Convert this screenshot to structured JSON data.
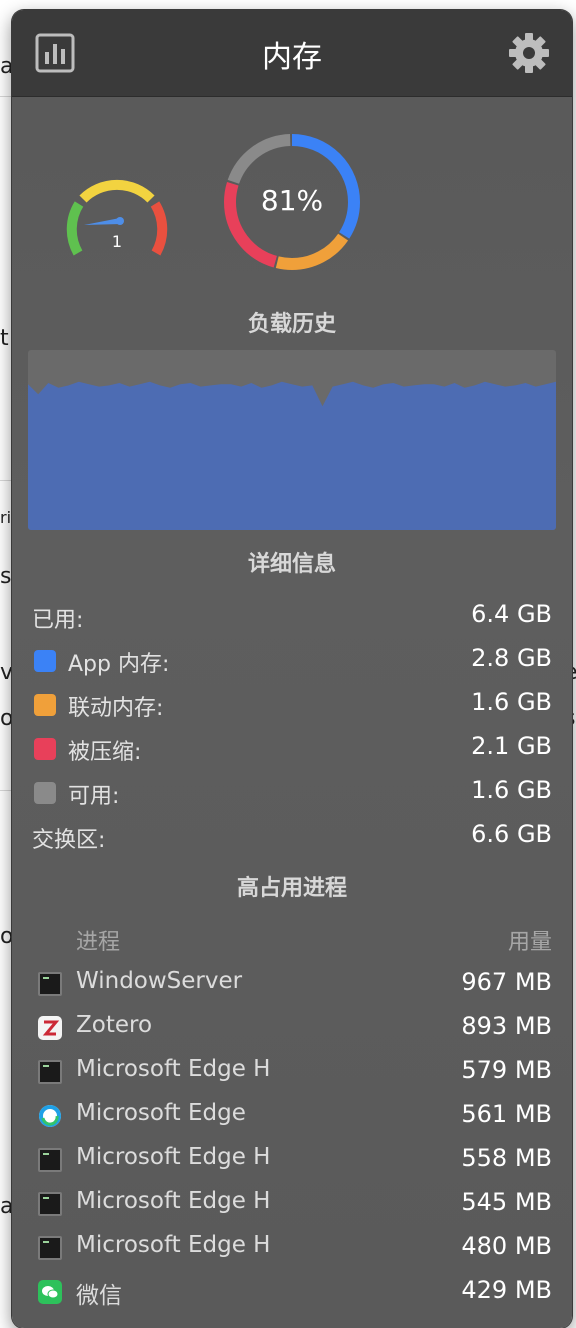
{
  "background": {
    "edge_left": [
      "a",
      "t",
      "ri",
      "se",
      "v",
      "o",
      "o",
      "a"
    ],
    "edge_right": [
      "e",
      "s"
    ]
  },
  "header": {
    "title": "内存"
  },
  "gauges": {
    "pressure_value": "1",
    "usage_percent": "81%",
    "ring_segments": [
      {
        "name": "App 内存",
        "value": 2.8,
        "color": "#3b82f6"
      },
      {
        "name": "联动内存",
        "value": 1.6,
        "color": "#f0a03a"
      },
      {
        "name": "被压缩",
        "value": 2.1,
        "color": "#e8405a"
      },
      {
        "name": "可用",
        "value": 1.6,
        "color": "#8a8a8a"
      }
    ]
  },
  "history": {
    "title": "负载历史",
    "fill_color": "#4d6cb3",
    "level_percent": 81
  },
  "details": {
    "title": "详细信息",
    "rows": [
      {
        "label": "已用:",
        "value": "6.4 GB"
      },
      {
        "label": "App 内存:",
        "value": "2.8 GB",
        "color": "#3b82f6"
      },
      {
        "label": "联动内存:",
        "value": "1.6 GB",
        "color": "#f0a03a"
      },
      {
        "label": "被压缩:",
        "value": "2.1 GB",
        "color": "#e8405a"
      },
      {
        "label": "可用:",
        "value": "1.6 GB",
        "color": "#8a8a8a"
      },
      {
        "label": "交换区:",
        "value": "6.6 GB"
      }
    ]
  },
  "processes": {
    "title": "高占用进程",
    "col_name": "进程",
    "col_usage": "用量",
    "rows": [
      {
        "name": "WindowServer",
        "value": "967 MB",
        "icon": "terminal-icon"
      },
      {
        "name": "Zotero",
        "value": "893 MB",
        "icon": "zotero-icon"
      },
      {
        "name": "Microsoft Edge H",
        "value": "579 MB",
        "icon": "terminal-icon"
      },
      {
        "name": "Microsoft Edge",
        "value": "561 MB",
        "icon": "edge-icon"
      },
      {
        "name": "Microsoft Edge H",
        "value": "558 MB",
        "icon": "terminal-icon"
      },
      {
        "name": "Microsoft Edge H",
        "value": "545 MB",
        "icon": "terminal-icon"
      },
      {
        "name": "Microsoft Edge H",
        "value": "480 MB",
        "icon": "terminal-icon"
      },
      {
        "name": "微信",
        "value": "429 MB",
        "icon": "wechat-icon"
      }
    ]
  }
}
